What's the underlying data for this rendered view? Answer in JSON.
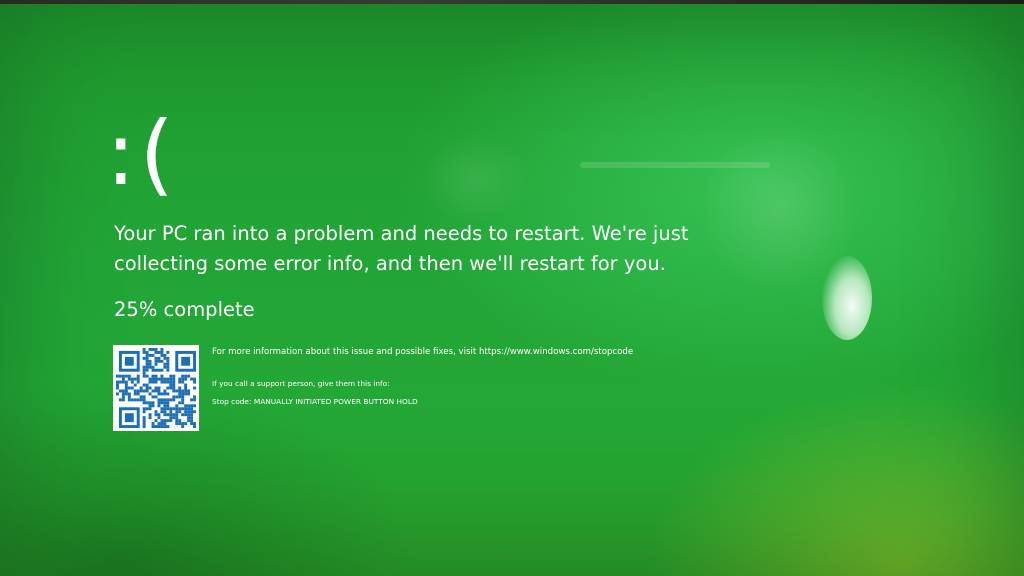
{
  "screen": {
    "background_color": "#23a736",
    "text_color": "#ffffff"
  },
  "sad_face": ":(",
  "message": "Your PC ran into a problem and needs to restart. We're just collecting some error info, and then we'll restart for you.",
  "progress": {
    "percent": 25,
    "text": "25% complete"
  },
  "qr_code": {
    "icon": "qr-code-icon"
  },
  "info": {
    "more_info": "For more information about this issue and possible fixes, visit https://www.windows.com/stopcode",
    "support_prompt": "If you call a support person, give them this info:",
    "stop_code": "Stop code: MANUALLY INITIATED POWER BUTTON HOLD"
  }
}
